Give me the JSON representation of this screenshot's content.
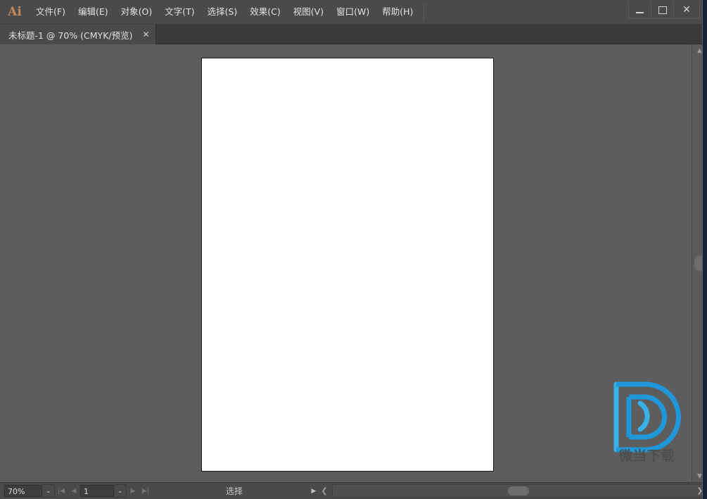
{
  "app": {
    "logo_text": "Ai",
    "logo_color": "#c08a5e"
  },
  "menu": {
    "items": [
      {
        "label": "文件(F)",
        "name": "menu-file"
      },
      {
        "label": "编辑(E)",
        "name": "menu-edit"
      },
      {
        "label": "对象(O)",
        "name": "menu-object"
      },
      {
        "label": "文字(T)",
        "name": "menu-type"
      },
      {
        "label": "选择(S)",
        "name": "menu-select"
      },
      {
        "label": "效果(C)",
        "name": "menu-effect"
      },
      {
        "label": "视图(V)",
        "name": "menu-view"
      },
      {
        "label": "窗口(W)",
        "name": "menu-window"
      },
      {
        "label": "帮助(H)",
        "name": "menu-help"
      }
    ]
  },
  "window_controls": {
    "minimize": "minimize-icon",
    "maximize": "maximize-icon",
    "close": "✕"
  },
  "tabs": [
    {
      "label": "未标题-1 @ 70% (CMYK/预览)",
      "close": "✕",
      "active": true
    }
  ],
  "canvas": {
    "background_color": "#5d5d5d",
    "artboard_color": "#ffffff"
  },
  "watermark": {
    "text": "微当下载",
    "logo_color": "#2aa3e0",
    "text_color": "#4e4e4e"
  },
  "scrollbars": {
    "vertical_up": "▲",
    "vertical_down": "▼",
    "horizontal_right": "❯"
  },
  "statusbar": {
    "zoom_value": "70%",
    "zoom_dropdown": "⌄",
    "first_page": "|◀",
    "prev_page": "◀",
    "page_value": "1",
    "page_dropdown": "⌄",
    "next_page": "▶",
    "last_page": "▶|",
    "tool_label": "选择",
    "tool_arrow": "▶",
    "tool_chevron": "❮"
  }
}
